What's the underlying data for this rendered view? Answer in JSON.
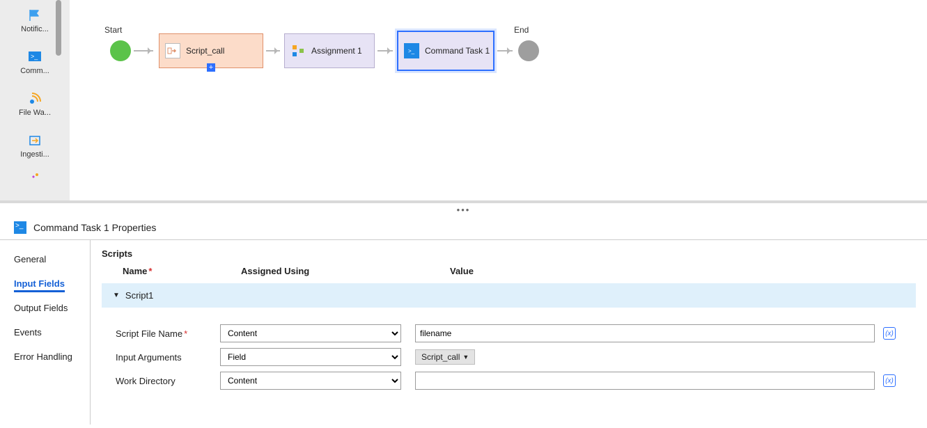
{
  "palette": {
    "items": [
      {
        "label": "Notific...",
        "name": "notification-palette-item"
      },
      {
        "label": "Comm...",
        "name": "command-palette-item"
      },
      {
        "label": "File Wa...",
        "name": "file-wait-palette-item"
      },
      {
        "label": "Ingesti...",
        "name": "ingestion-palette-item"
      }
    ]
  },
  "canvas": {
    "start_label": "Start",
    "end_label": "End",
    "nodes": {
      "script_call": "Script_call",
      "assignment": "Assignment 1",
      "command_task": "Command Task 1"
    }
  },
  "properties": {
    "title": "Command Task 1 Properties",
    "tabs": [
      "General",
      "Input Fields",
      "Output Fields",
      "Events",
      "Error Handling"
    ],
    "active_tab": 1,
    "section": "Scripts",
    "columns": {
      "name": "Name",
      "assigned": "Assigned Using",
      "value": "Value"
    },
    "script_row": "Script1",
    "rows": [
      {
        "label": "Script File Name",
        "required": true,
        "select": "Content",
        "value_type": "text",
        "value": "filename",
        "has_fx": true
      },
      {
        "label": "Input Arguments",
        "required": false,
        "select": "Field",
        "value_type": "pill",
        "value": "Script_call",
        "has_fx": false
      },
      {
        "label": "Work Directory",
        "required": false,
        "select": "Content",
        "value_type": "text",
        "value": "",
        "has_fx": true
      }
    ],
    "select_options": {
      "content": "Content",
      "field": "Field"
    }
  }
}
